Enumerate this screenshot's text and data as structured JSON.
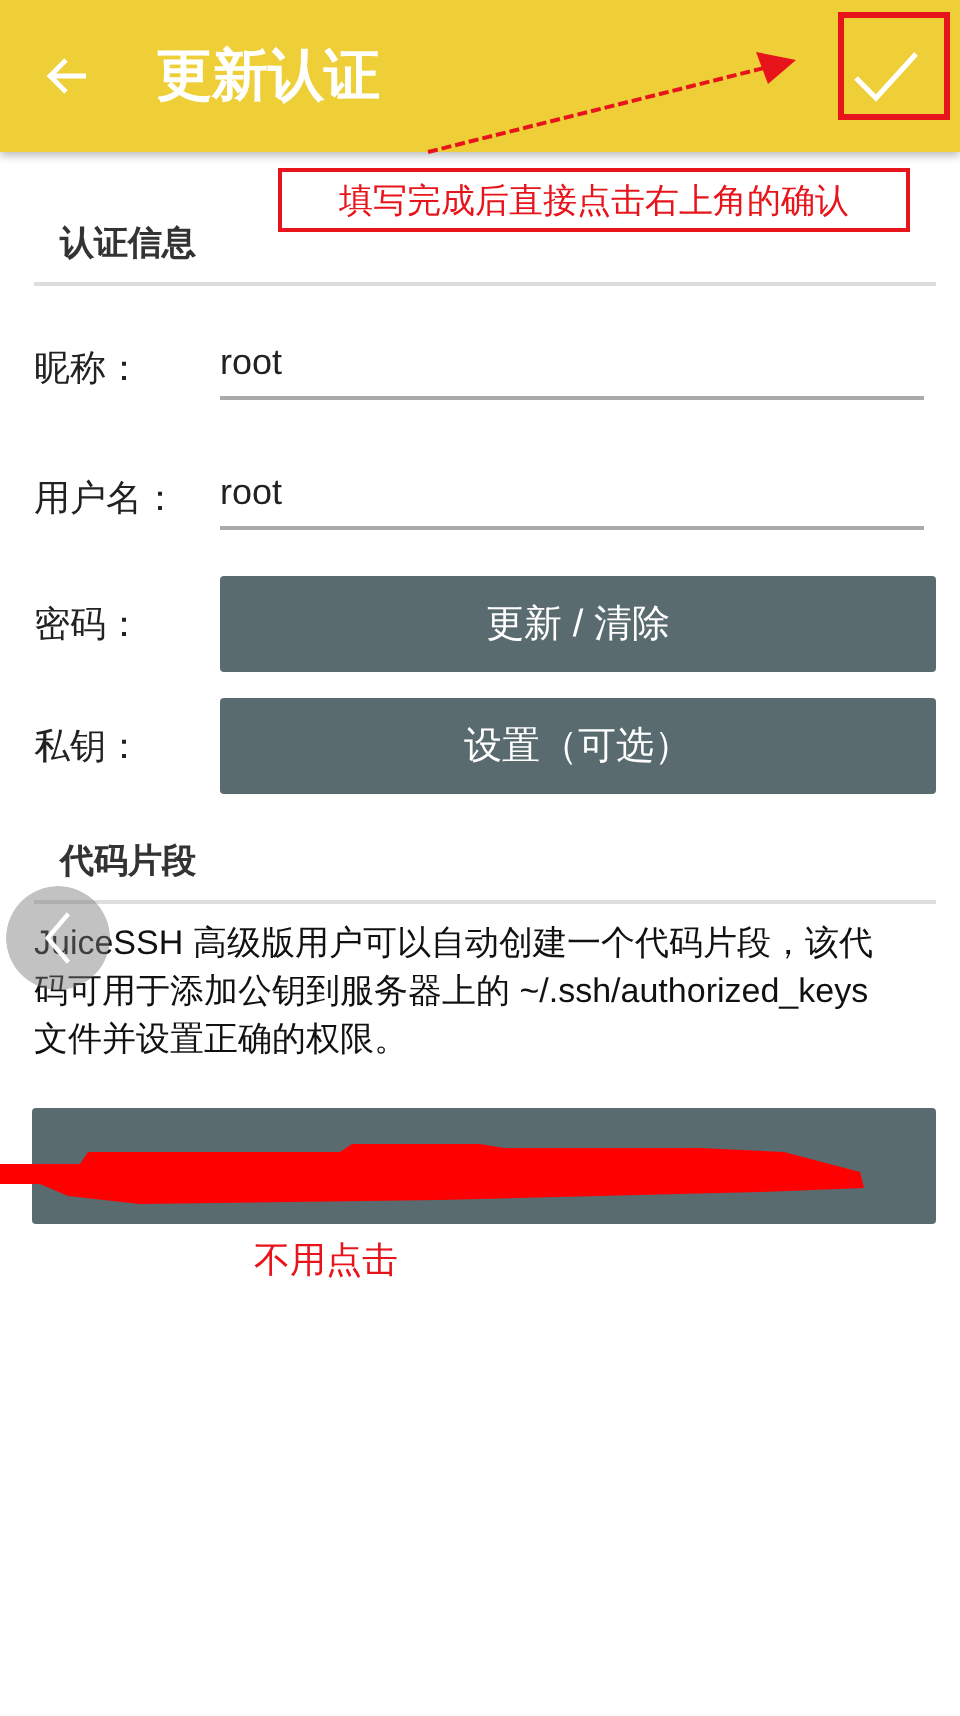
{
  "app_bar": {
    "title": "更新认证"
  },
  "auth_section": {
    "title": "认证信息",
    "fields": [
      {
        "kind": "text",
        "label": "昵称：",
        "value": "root"
      },
      {
        "kind": "text",
        "label": "用户名：",
        "value": "root"
      },
      {
        "kind": "button",
        "label": "密码：",
        "button": "更新 / 清除"
      },
      {
        "kind": "button",
        "label": "私钥：",
        "button": "设置（可选）"
      }
    ]
  },
  "snippet_section": {
    "title": "代码片段",
    "description": "JuiceSSH 高级版用户可以自动创建一个代码片段，该代码可用于添加公钥到服务器上的 ~/.ssh/authorized_keys 文件并设置正确的权限。"
  },
  "annotations": [
    {
      "kind": "callout",
      "text": "填写完成后直接点击右上角的确认"
    },
    {
      "kind": "note",
      "text": "不用点击"
    }
  ]
}
